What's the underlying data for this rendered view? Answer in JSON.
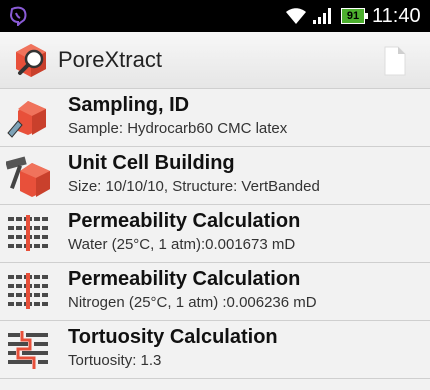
{
  "status_bar": {
    "time": "11:40",
    "battery": "91",
    "icons": [
      "viber-icon",
      "wifi-icon",
      "signal-icon",
      "battery-icon"
    ]
  },
  "action_bar": {
    "title": "PoreXtract",
    "app_icon": "porextract-logo-icon",
    "action_icon": "document-icon"
  },
  "items": [
    {
      "title": "Sampling, ID",
      "subtitle": "Sample: Hydrocarb60 CMC latex",
      "icon": "sampling-cube-icon"
    },
    {
      "title": "Unit Cell Building",
      "subtitle": "Size: 10/10/10, Structure: VertBanded",
      "icon": "hammer-cube-icon"
    },
    {
      "title": "Permeability Calculation",
      "subtitle": "Water (25°C, 1 atm):0.001673 mD",
      "icon": "grid-flow-icon"
    },
    {
      "title": "Permeability Calculation",
      "subtitle": "Nitrogen (25°C, 1 atm) :0.006236 mD",
      "icon": "grid-flow-icon"
    },
    {
      "title": "Tortuosity Calculation",
      "subtitle": "Tortuosity: 1.3",
      "icon": "maze-path-icon"
    }
  ],
  "colors": {
    "accent_red": "#e8503a",
    "battery_green": "#4caf2e",
    "list_bg": "#f2f2f2"
  }
}
